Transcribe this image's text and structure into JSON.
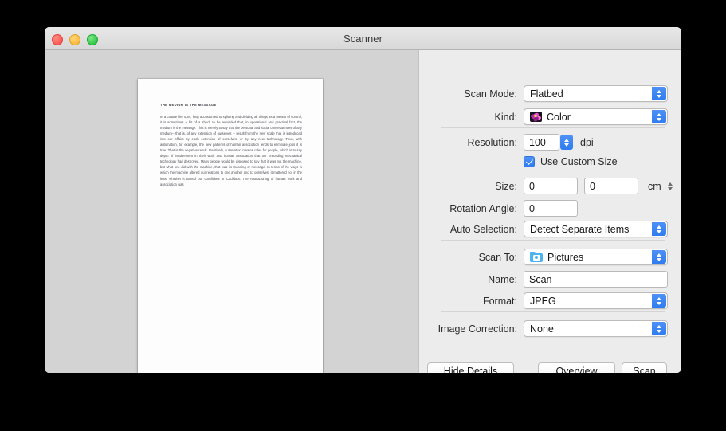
{
  "window": {
    "title": "Scanner",
    "traffic_lights": [
      "close-button",
      "minimize-button",
      "maximize-button"
    ]
  },
  "preview": {
    "document": {
      "heading": "THE MEDIUM IS THE MESSAGE",
      "body": "In a culture like ours, long accustomed to splitting and dividing all things as a means of control, it is sometimes a bit of a shock to be reminded that, in operational and practical fact, the medium is the message. This is merely to say that the personal and social consequences of any medium-- that is, of any extension of ourselves -- result from the new scale that is introduced into our affairs by each extension of ourselves, or by any new technology. Thus, with automation, for example, the new patterns of human association tends to eliminate jobs it is true. That is the negative result. Positively, automation creates roles for people, which is to say depth of involvement in their work and human association that our preceding mechanical technology had destroyed. Many people would be disposed to say that it was not the machine, but what one did with the machine, that was its meaning or message. In terms of the ways in which the machine altered our relations to one another and to ourselves, it mattered not in the least whether it turned out cornflakes or Cadillacs. The restructuring of human work and association was"
    }
  },
  "controls": {
    "scan_mode": {
      "label": "Scan Mode:",
      "value": "Flatbed"
    },
    "kind": {
      "label": "Kind:",
      "value": "Color",
      "icon": "color-swatch-icon"
    },
    "resolution": {
      "label": "Resolution:",
      "value": "100",
      "unit": "dpi"
    },
    "use_custom_size": {
      "label": "Use Custom Size",
      "checked": true
    },
    "size": {
      "label": "Size:",
      "width": "0",
      "height": "0",
      "unit": "cm"
    },
    "rotation_angle": {
      "label": "Rotation Angle:",
      "value": "0"
    },
    "auto_selection": {
      "label": "Auto Selection:",
      "value": "Detect Separate Items"
    },
    "scan_to": {
      "label": "Scan To:",
      "value": "Pictures",
      "icon": "pictures-folder-icon"
    },
    "name": {
      "label": "Name:",
      "value": "Scan"
    },
    "format": {
      "label": "Format:",
      "value": "JPEG"
    },
    "image_correction": {
      "label": "Image Correction:",
      "value": "None"
    }
  },
  "buttons": {
    "hide_details": "Hide Details",
    "overview": "Overview",
    "scan": "Scan"
  },
  "colors": {
    "accent": "#2f7cf0",
    "panel": "#ececec",
    "preview_bg": "#d3d3d3"
  }
}
